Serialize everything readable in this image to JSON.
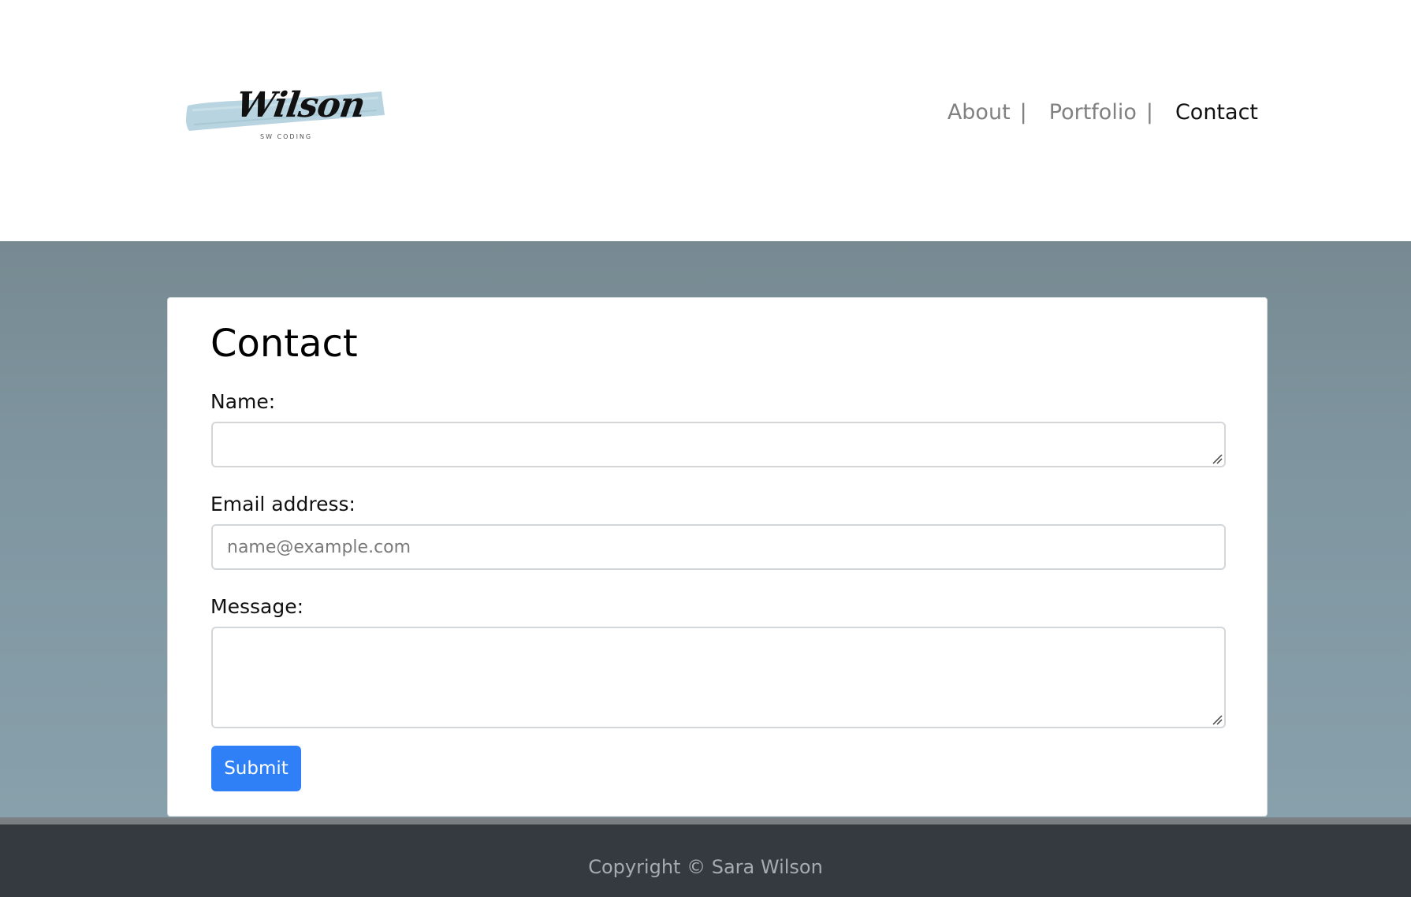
{
  "header": {
    "logo": {
      "script_text": "Wilson",
      "subtitle": "SW CODING",
      "brush_color": "#b8d4e0"
    },
    "nav": {
      "items": [
        {
          "label": "About",
          "separator": "|",
          "active": false
        },
        {
          "label": "Portfolio",
          "separator": "|",
          "active": false
        },
        {
          "label": "Contact",
          "active": true
        }
      ]
    }
  },
  "contact": {
    "title": "Contact",
    "name_label": "Name:",
    "name_value": "",
    "email_label": "Email address:",
    "email_placeholder": "name@example.com",
    "message_label": "Message:",
    "message_value": "",
    "submit_label": "Submit"
  },
  "footer": {
    "copyright": "Copyright © Sara Wilson"
  },
  "colors": {
    "accent": "#2f80f6",
    "footer_bg": "#343a40",
    "hero_bg": "#8097a2"
  }
}
